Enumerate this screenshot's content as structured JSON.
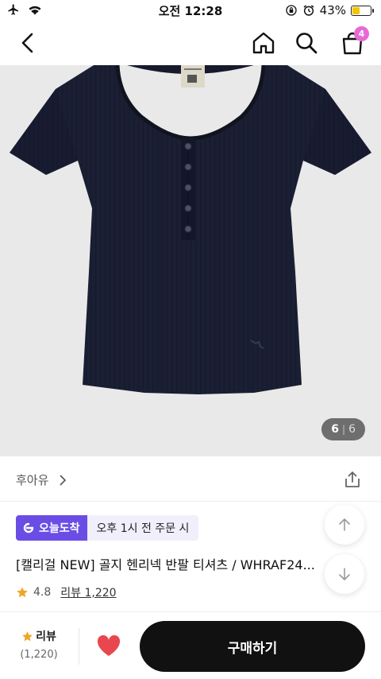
{
  "status_bar": {
    "time": "오전 12:28",
    "battery_percent": "43%",
    "battery_level": 0.43
  },
  "nav": {
    "cart_count": "4"
  },
  "image": {
    "current": "6",
    "total": "6"
  },
  "brand": {
    "name": "후아유"
  },
  "delivery": {
    "badge": "오늘도착",
    "note": "오후 1시 전 주문 시"
  },
  "product": {
    "title": "[캘리걸 NEW] 골지 헨리넥 반팔 티셔츠 / WHRAF24..."
  },
  "rating": {
    "score": "4.8",
    "review_label": "리뷰 1,220"
  },
  "bottom": {
    "review_label": "리뷰",
    "review_count": "(1,220)",
    "buy_label": "구매하기"
  },
  "colors": {
    "accent": "#6b4de6",
    "badge": "#e56ad6",
    "heart": "#e8474d",
    "star": "#f0a52a",
    "garment": "#1b1f33"
  }
}
